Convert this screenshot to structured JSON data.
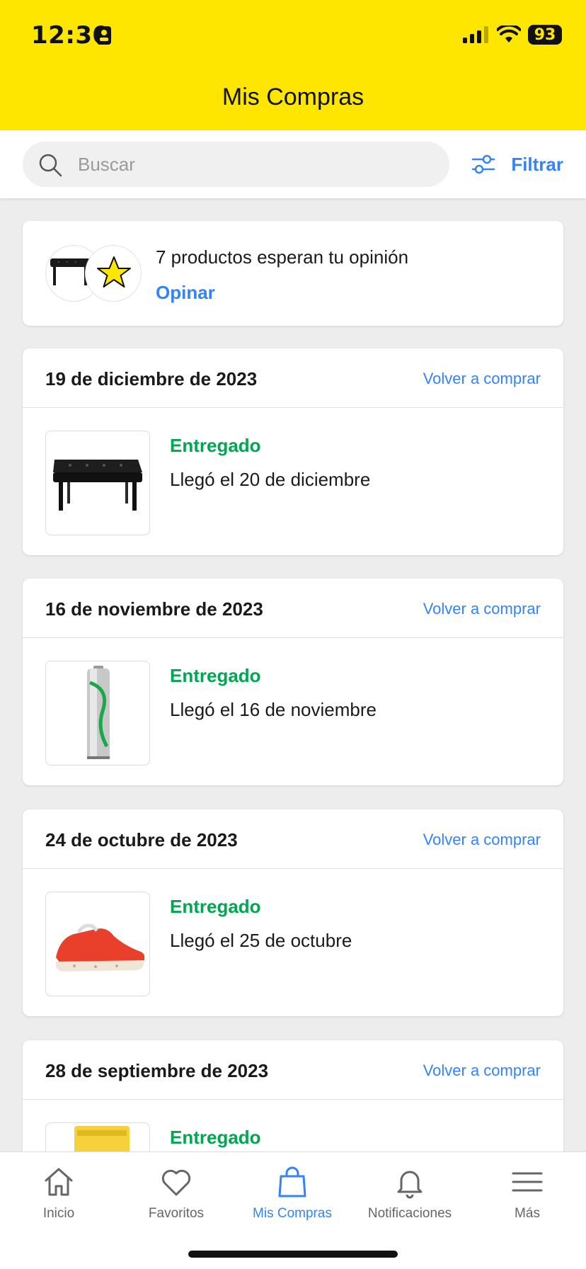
{
  "status_bar": {
    "time": "12:30",
    "battery": "93"
  },
  "header": {
    "title": "Mis Compras"
  },
  "search": {
    "placeholder": "Buscar",
    "filter_label": "Filtrar"
  },
  "review_prompt": {
    "text": "7 productos esperan tu opinión",
    "action": "Opinar"
  },
  "orders": [
    {
      "date": "19 de diciembre de 2023",
      "rebuy": "Volver a comprar",
      "status": "Entregado",
      "arrival": "Llegó el 20 de diciembre",
      "product_icon": "bench-image"
    },
    {
      "date": "16 de noviembre de 2023",
      "rebuy": "Volver a comprar",
      "status": "Entregado",
      "arrival": "Llegó el 16 de noviembre",
      "product_icon": "battery-image"
    },
    {
      "date": "24 de octubre de 2023",
      "rebuy": "Volver a comprar",
      "status": "Entregado",
      "arrival": "Llegó el 25 de octubre",
      "product_icon": "sneaker-image"
    },
    {
      "date": "28 de septiembre de 2023",
      "rebuy": "Volver a comprar",
      "status": "Entregado",
      "arrival": "",
      "product_icon": "package-image"
    }
  ],
  "tabs": [
    {
      "label": "Inicio",
      "icon": "home-icon"
    },
    {
      "label": "Favoritos",
      "icon": "heart-icon"
    },
    {
      "label": "Mis Compras",
      "icon": "shopping-bag-icon",
      "active": true
    },
    {
      "label": "Notificaciones",
      "icon": "bell-icon"
    },
    {
      "label": "Más",
      "icon": "menu-icon"
    }
  ],
  "colors": {
    "brand_yellow": "#ffe600",
    "link_blue": "#3483fa",
    "delivered_green": "#00a650"
  }
}
